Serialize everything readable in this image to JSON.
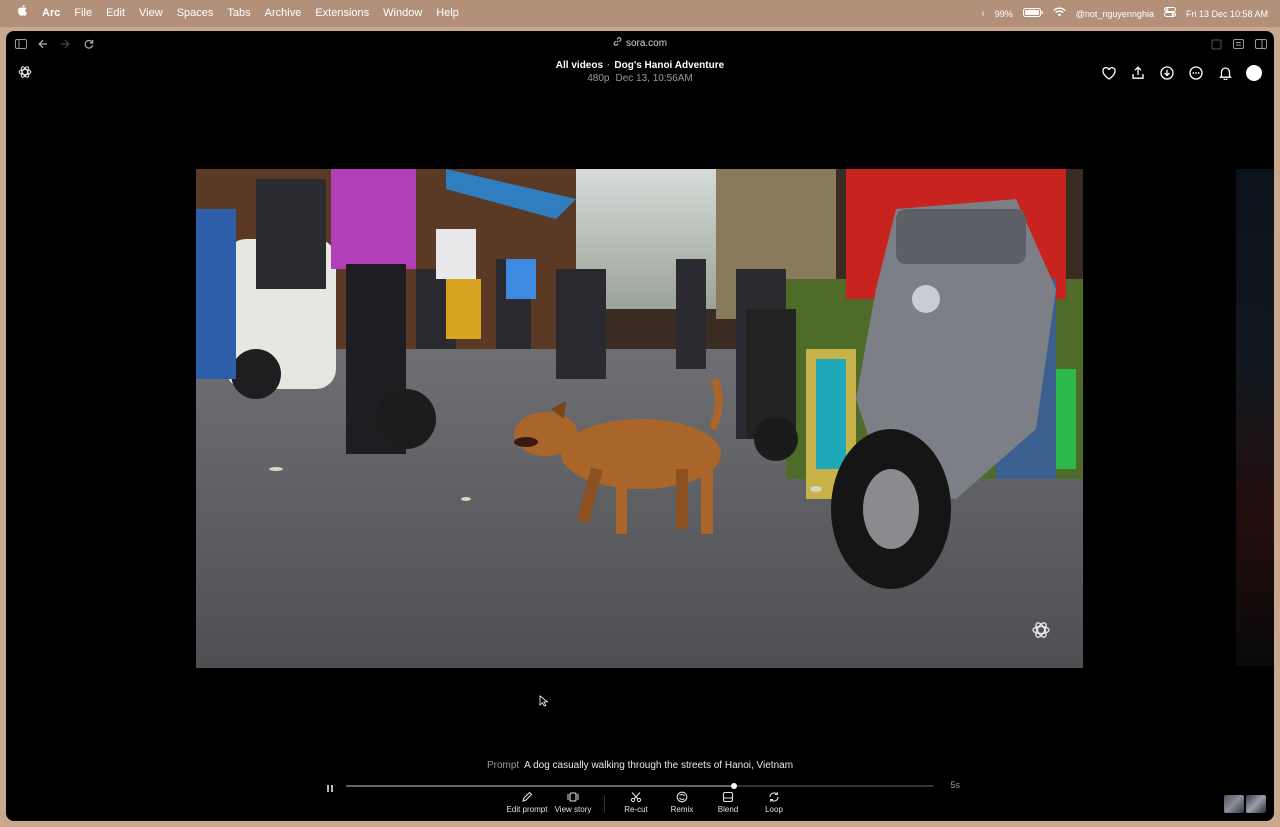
{
  "menubar": {
    "apple_icon": "apple-logo-icon",
    "app_name": "Arc",
    "items": [
      "File",
      "Edit",
      "View",
      "Spaces",
      "Tabs",
      "Archive",
      "Extensions",
      "Window",
      "Help"
    ],
    "battery": "99%",
    "user": "@not_nguyennghia",
    "datetime": "Fri 13 Dec  10:58 AM"
  },
  "browser": {
    "url": "sora.com"
  },
  "header": {
    "breadcrumb_root": "All videos",
    "separator": "·",
    "title": "Dog's Hanoi Adventure",
    "resolution": "480p",
    "date": "Dec 13, 10:56AM"
  },
  "player": {
    "progress": 0.66,
    "duration": "5s"
  },
  "prompt": {
    "label": "Prompt",
    "text": "A dog casually walking through the streets of Hanoi, Vietnam"
  },
  "actions": {
    "edit_prompt": "Edit prompt",
    "view_story": "View story",
    "recut": "Re-cut",
    "remix": "Remix",
    "blend": "Blend",
    "loop": "Loop"
  },
  "colors": {
    "window_bg": "#000000",
    "desktop_bg": "#c9a88e",
    "dog": "#a9652a",
    "scooter": "#7c7f86",
    "jacket": "#c8231e",
    "hoodie": "#b23fb8"
  }
}
